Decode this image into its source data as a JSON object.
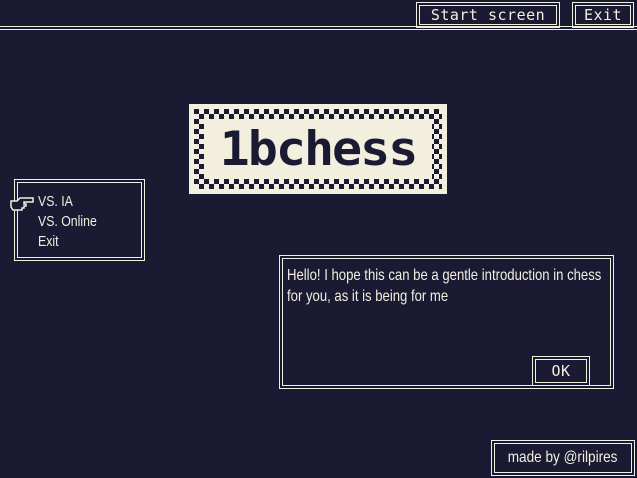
{
  "top_bar": {
    "start_screen_label": "Start screen",
    "exit_label": "Exit"
  },
  "logo": {
    "text": "1bchess"
  },
  "menu": {
    "items": [
      {
        "label": "VS. IA",
        "selected": true
      },
      {
        "label": "VS. Online",
        "selected": false
      },
      {
        "label": "Exit",
        "selected": false
      }
    ],
    "pointer_icon": "hand-pointer-icon"
  },
  "dialog": {
    "message": "Hello! I hope this can be a gentle introduction in chess for you, as it is being for me",
    "ok_label": "OK"
  },
  "credit": {
    "text": "made by @rilpires"
  },
  "colors": {
    "background": "#1b1a33",
    "foreground": "#f2efdf"
  }
}
